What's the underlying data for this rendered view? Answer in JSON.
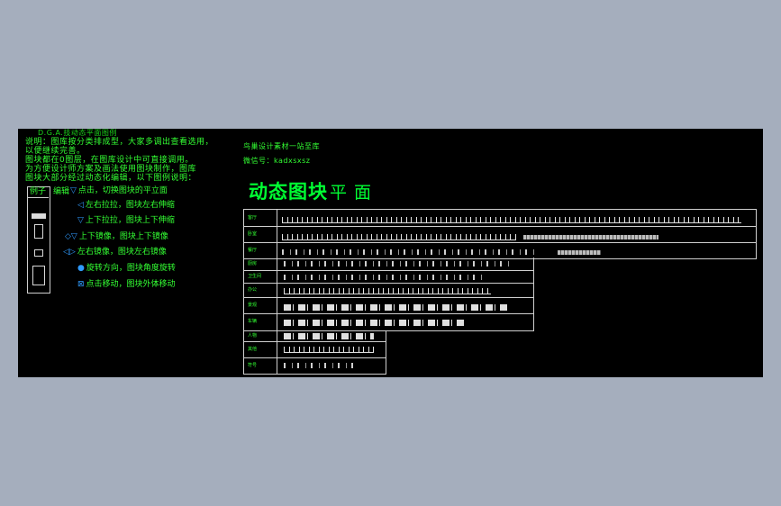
{
  "notes": {
    "heading": "D.G.A.技动态平面图例",
    "lines": [
      "说明：图库按分类排成型，大家多调出查看选用，",
      "以便继续完善。",
      "图块都在0图层，在图库设计中可直接调用。",
      "为方便设计师方案及画法使用图块制作，图库",
      "图块大部分经过动态化编辑，以下图例说明："
    ]
  },
  "legend": {
    "col1": "例子",
    "col2": "编辑",
    "items": [
      {
        "icon": "▽",
        "text": "点击，切换图块的平立面"
      },
      {
        "icon": "◁",
        "text": "左右拉拉，图块左右伸缩"
      },
      {
        "icon": "▽",
        "text": "上下拉拉，图块上下伸缩"
      },
      {
        "icon": "◇▽",
        "text": "上下镜像，图块上下镜像"
      },
      {
        "icon": "◁▷",
        "text": "左右镜像，图块左右镜像"
      },
      {
        "icon": "●",
        "text": "旋转方向，图块角度旋转"
      },
      {
        "icon": "⊠",
        "text": "点击移动，图块外体移动"
      }
    ]
  },
  "header_right": {
    "line1": "鸟巢设计素材一站至库",
    "line2": "微信号：kadxsxsz"
  },
  "title": {
    "part1": "动态图块",
    "part2": "平 面"
  },
  "table": {
    "row_labels": [
      "客厅",
      "卧室",
      "餐厅",
      "厨房",
      "卫生间",
      "办公",
      "景观",
      "车辆",
      "人物",
      "其他",
      "符号"
    ]
  },
  "colors": {
    "background": "#a5aebd",
    "canvas": "#000000",
    "text_green": "#33ff33",
    "title_green": "#00ff33",
    "icon_blue": "#2f9bff",
    "line_gray": "#cfcfcf"
  }
}
